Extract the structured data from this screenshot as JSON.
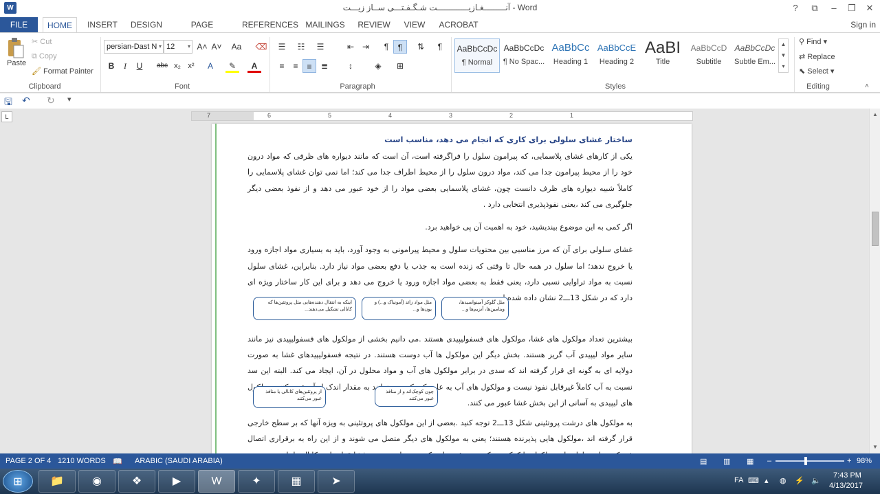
{
  "window": {
    "title": "آنـــــــــغـازیـــــــــــــت شـگـفـتـــی ســاز زیـــت - Word",
    "app_icon": "W",
    "controls": [
      "?",
      "⧉",
      "–",
      "❐",
      "✕"
    ]
  },
  "tabs": {
    "file": "FILE",
    "items": [
      "HOME",
      "INSERT",
      "DESIGN",
      "PAGE LAYOUT",
      "REFERENCES",
      "MAILINGS",
      "REVIEW",
      "VIEW",
      "ACROBAT"
    ],
    "signin": "Sign in"
  },
  "ribbon": {
    "clipboard": {
      "label": "Clipboard",
      "paste": "Paste",
      "cut": "Cut",
      "copy": "Copy",
      "format_painter": "Format Painter"
    },
    "font": {
      "label": "Font",
      "font_name": "persian-Dast N",
      "font_size": "12",
      "grow": "A˄",
      "shrink": "A˅",
      "change_case": "Aa",
      "bold": "B",
      "italic": "I",
      "underline": "U",
      "strikethrough": "abc",
      "subscript": "x₂",
      "superscript": "x²"
    },
    "paragraph": {
      "label": "Paragraph"
    },
    "styles": {
      "label": "Styles",
      "items": [
        {
          "sample": "AaBbCcDc",
          "name": "¶ Normal"
        },
        {
          "sample": "AaBbCcDc",
          "name": "¶ No Spac..."
        },
        {
          "sample": "AaBbCc",
          "name": "Heading 1"
        },
        {
          "sample": "AaBbCcE",
          "name": "Heading 2"
        },
        {
          "sample": "AaBI",
          "name": "Title"
        },
        {
          "sample": "AaBbCcD",
          "name": "Subtitle"
        },
        {
          "sample": "AaBbCcDc",
          "name": "Subtle Em..."
        }
      ]
    },
    "editing": {
      "label": "Editing",
      "find": "Find",
      "replace": "Replace",
      "select": "Select"
    }
  },
  "ruler_ticks": [
    "7",
    "6",
    "5",
    "4",
    "3",
    "2",
    "1"
  ],
  "document": {
    "heading": "ساختار غشای سلولی برای کاری که انجام می دهد، مناسب است",
    "paragraphs": [
      "یکی از کارهای غشای پلاسمایی، که پیرامون سلول را فراگرفته است، آن است که مانند دیواره های ظرفی که مواد درون خود را از محیط پیرامون جدا می کند، مواد درون سلول را از محیط اطراف جدا می کند؛ اما نمی توان غشای پلاسمایی را کاملاً شبیه دیواره های ظرف دانست چون، غشای پلاسمایی بعضی مواد را از خود عبور می دهد و از نفوذ بعضی دیگر جلوگیری می کند ،یعنی نفوذپذیری انتخابی دارد .",
      "اگر کمی به این موضوع بیندیشید، خود به اهمیت آن پی خواهید برد.",
      "غشای سلولی برای آن که مرز مناسبی بین محتویات سلول و محیط پیرامونی به وجود آورد، باید به بسیاری مواد اجازه ورود یا خروج ندهد؛ اما سلول در همه حال تا وقتی که زنده است به جذب یا دفع بعضی مواد نیاز دارد. بنابراین، غشای سلول نسبت به مواد تراوایی نسبی دارد، یعنی فقط به بعضی مواد اجازه ورود یا خروج می دهد و برای این کار ساختار ویژه ای دارد که در شکل 13ـــ2 نشان داده شده است.",
      "بیشترین تعداد مولکول های غشا، مولکول های فسفولیپیدی هستند .می دانیم بخشی از مولکول های فسفولیپیدی نیز مانند سایر مواد لیپیدی آب گریز هستند. بخش دیگر این مولکول ها آب دوست هستند. در نتیجه فسفولیپیدهای غشا به صورت دولایه ای به گونه ای قرار گرفته اند که سدی در برابر مولکول های آب و مواد محلول در آن، ایجاد می کند. البته این سد نسبت به آب کاملاً غیرقابل نفوذ نیست و مولکول های آب به علت کوچکی می توانند به مقدار اندک از آن عبور کنند. مولکول های لیپیدی به آسانی از این بخش غشا عبور می کنند.",
      "به مولکول های درشت پروتئینی شکل 13ـــ2 توجه کنید .بعضی از این مولکول های پروتئینی به ویژه آنها که بر سطح خارجی قرار گرفته اند ،مولکول هایی پذیرنده هستند؛ یعنی به مولکول های دیگر متصل می شوند و از این راه به برقراری اتصال فیزیکی میان سلول ها و مولکول ها کمک می کنند. پروتئین هایی که در سراسر عرض غشا قرار دارند کانال ها یا"
    ],
    "callouts": [
      "مثل گلوکز آمینواسیدها، ویتامین‌ها، آنزیم‌ها و...",
      "مثل مواد زائد (آمونیاک و...) و یون‌ها و...",
      "اینکه به انتقال دهنده‌هایی مثل پروتئین‌ها که کانالی تشکیل می‌دهند...",
      "چون کوچک‌اند و از منافذ عبور می‌کنند",
      "از پروتئین‌های کانالی یا منافذ عبور می‌کنند"
    ]
  },
  "statusbar": {
    "page": "PAGE 2 OF 4",
    "words": "1210 WORDS",
    "language": "ARABIC (SAUDI ARABIA)",
    "zoom_percent": "98%",
    "zoom_minus": "–",
    "zoom_plus": "+"
  },
  "taskbar": {
    "apps": [
      "explorer",
      "chrome",
      "photos",
      "media-player",
      "word",
      "acrobat",
      "winrar",
      "telegram"
    ],
    "lang": "FA",
    "time": "7:43 PM",
    "date": "4/13/2017"
  },
  "colors": {
    "accent": "#2b579a",
    "heading": "#2e4a8a"
  }
}
